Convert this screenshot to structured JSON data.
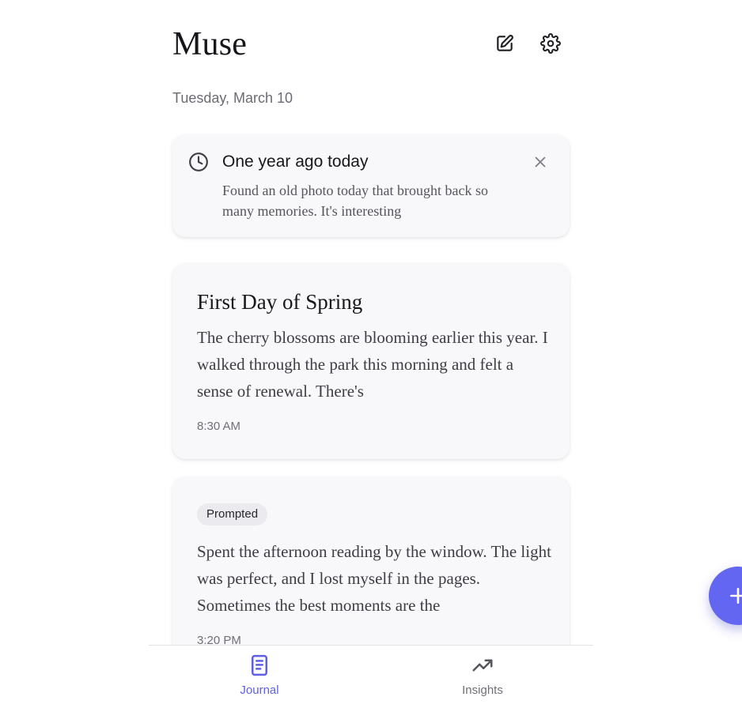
{
  "header": {
    "title": "Muse",
    "date": "Tuesday, March 10",
    "icons": [
      "edit-icon",
      "gear-icon"
    ]
  },
  "memory": {
    "title": "One year ago today",
    "body": "Found an old photo today that brought back so many memories. It's interesting",
    "icon": "clock-icon"
  },
  "entries": [
    {
      "title": "First Day of Spring",
      "body": "The cherry blossoms are blooming earlier this year. I walked through the park this morning and felt a sense of renewal. There's",
      "time": "8:30 AM"
    },
    {
      "badge": "Prompted",
      "body": "Spent the afternoon reading by the window. The light was perfect, and I lost myself in the pages. Sometimes the best moments are the",
      "time": "3:20 PM"
    }
  ],
  "nav": {
    "items": [
      {
        "label": "Journal",
        "icon": "notebook-icon",
        "active": true
      },
      {
        "label": "Insights",
        "icon": "trending-up-icon",
        "active": false
      }
    ]
  },
  "fab": {
    "icon": "plus-icon"
  },
  "colors": {
    "accent": "#6366f1",
    "card_bg": "#f8f8fa",
    "muted_text": "#6b6b73"
  }
}
